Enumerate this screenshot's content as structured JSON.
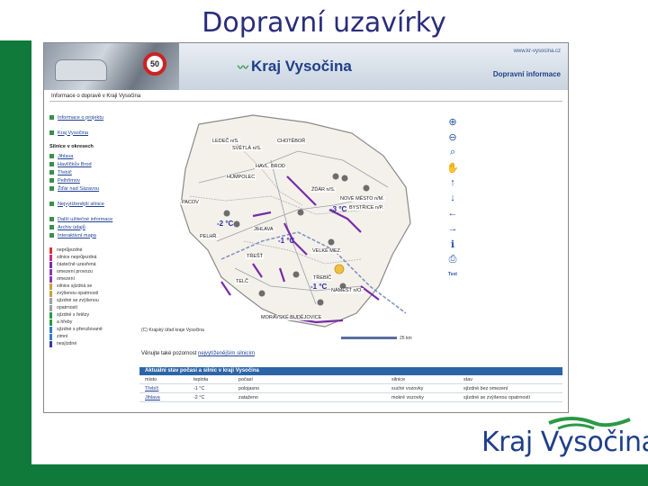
{
  "slide": {
    "title": "Dopravní uzavírky"
  },
  "banner": {
    "sign_text": "50",
    "logo_text": "Kraj Vysočina",
    "url": "www.kr-vysocina.cz",
    "section": "Dopravní informace"
  },
  "breadcrumb": "Informace o dopravě v Kraji Vysočina",
  "sidebar": {
    "top_links": [
      "Informace o projektu",
      "Kraj Vysočina"
    ],
    "districts_heading": "Silnice v okresech",
    "districts": [
      "Jihlava",
      "Havlíčkův Brod",
      "Třebíč",
      "Pelhřimov",
      "Žďár nad Sázavou"
    ],
    "special_link": "Nejvytíženější silnice",
    "other_links": [
      "Další užitečné informace",
      "Archiv údajů",
      "Interaktivní mapa"
    ]
  },
  "legend": [
    {
      "label": "neprůjezdné",
      "color": "#e03030"
    },
    {
      "label": "silnice neprůjezdná",
      "color": "#cc2a8a"
    },
    {
      "label": "částečně uzavřená",
      "color": "#7a2aa8"
    },
    {
      "label": "omezení provozu",
      "color": "#8a3ab0"
    },
    {
      "label": "omezení",
      "color": "#8a3ab0"
    },
    {
      "label": "silnice sjízdná se",
      "color": "#c8a040"
    },
    {
      "label": "zvýšenou opatrností",
      "color": "#c8a040"
    },
    {
      "label": "sjízdné se zvýšenou",
      "color": "#9aa0a8"
    },
    {
      "label": "opatrností",
      "color": "#9aa0a8"
    },
    {
      "label": "sjízdné s řetězy",
      "color": "#2a9a45"
    },
    {
      "label": "a hřeby",
      "color": "#2a9a45"
    },
    {
      "label": "sjízdné s přerušovaně",
      "color": "#2a80c8"
    },
    {
      "label": "zimní",
      "color": "#2a80c8"
    },
    {
      "label": "nesjízdné",
      "color": "#3a3aa0"
    }
  ],
  "map": {
    "labels": {
      "ledec": "LEDEČ n/S.",
      "svetla": "SVĚTLÁ n/S.",
      "chotebor": "CHOTĚBOŘ",
      "hbrod": "HAVL. BROD",
      "humpolec": "HUMPOLEC",
      "zdar": "ŽĎÁR n/S.",
      "nmesto": "NOVÉ MĚSTO n/M.",
      "bystrice": "BYSTŘICE n/P.",
      "pacov": "PACOV",
      "jihlava": "JIHLAVA",
      "pelhrimov": "PELHŘ.",
      "velkem": "VELKÉ MEZ.",
      "trest": "TŘEŠŤ",
      "telc": "TELČ",
      "trebic": "TŘEBÍČ",
      "namest": "NÁMĚŠŤ n/O.",
      "mbud": "MORAVSKÉ BUDĚJOVICE"
    },
    "temps": [
      "-2 °C",
      "-3 °C",
      "-1 °C",
      "-1 °C"
    ],
    "copyright": "(C) Krajský úřad kraje Vysočina",
    "scale": "25 km"
  },
  "toolbar": {
    "text_button": "Text"
  },
  "more_line": {
    "prefix": "Věnujte také pozornost",
    "link": "nejvytíženějším silnicím"
  },
  "table": {
    "title": "Aktuální stav počasí a silnic v kraji Vysočina",
    "columns": [
      "místo",
      "teplota",
      "počasí",
      "silnice",
      "stav"
    ],
    "rows": [
      {
        "place": "Třebíč",
        "temp": "-1 °C",
        "weather": "polojasno",
        "road": "suché vozovky",
        "state": "sjízdné bez omezení"
      },
      {
        "place": "Jihlava",
        "temp": "-2 °C",
        "weather": "zataženo",
        "road": "mokré vozovky",
        "state": "sjízdné se zvýšenou opatrností"
      }
    ]
  },
  "logo": {
    "text": "Kraj Vysočina"
  },
  "colors": {
    "accent_green": "#0f7a3a",
    "brand_blue": "#1f3f88",
    "closure_purple": "#7a2aa8"
  }
}
